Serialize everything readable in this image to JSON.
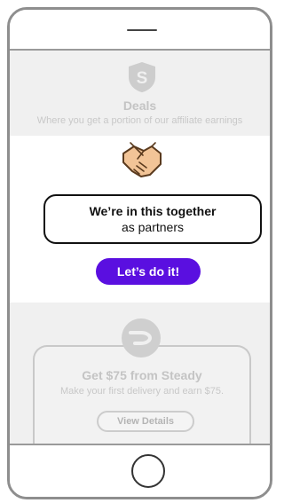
{
  "deals": {
    "title": "Deals",
    "subtitle": "Where you get a portion of our affiliate earnings"
  },
  "modal": {
    "title": "We’re in this together",
    "subtitle": "as partners",
    "cta_label": "Let’s do it!"
  },
  "offer": {
    "title": "Get $75 from Steady",
    "description": "Make your first delivery and earn $75.",
    "button_label": "View Details"
  },
  "colors": {
    "accent": "#5a0fe0",
    "muted_text": "#c4c4c4",
    "handshake_skin": "#f2c497",
    "handshake_outline": "#5a3a1e"
  },
  "icons": {
    "deals": "shield-s-icon",
    "modal": "handshake-icon",
    "offer": "steady-logo-icon"
  }
}
